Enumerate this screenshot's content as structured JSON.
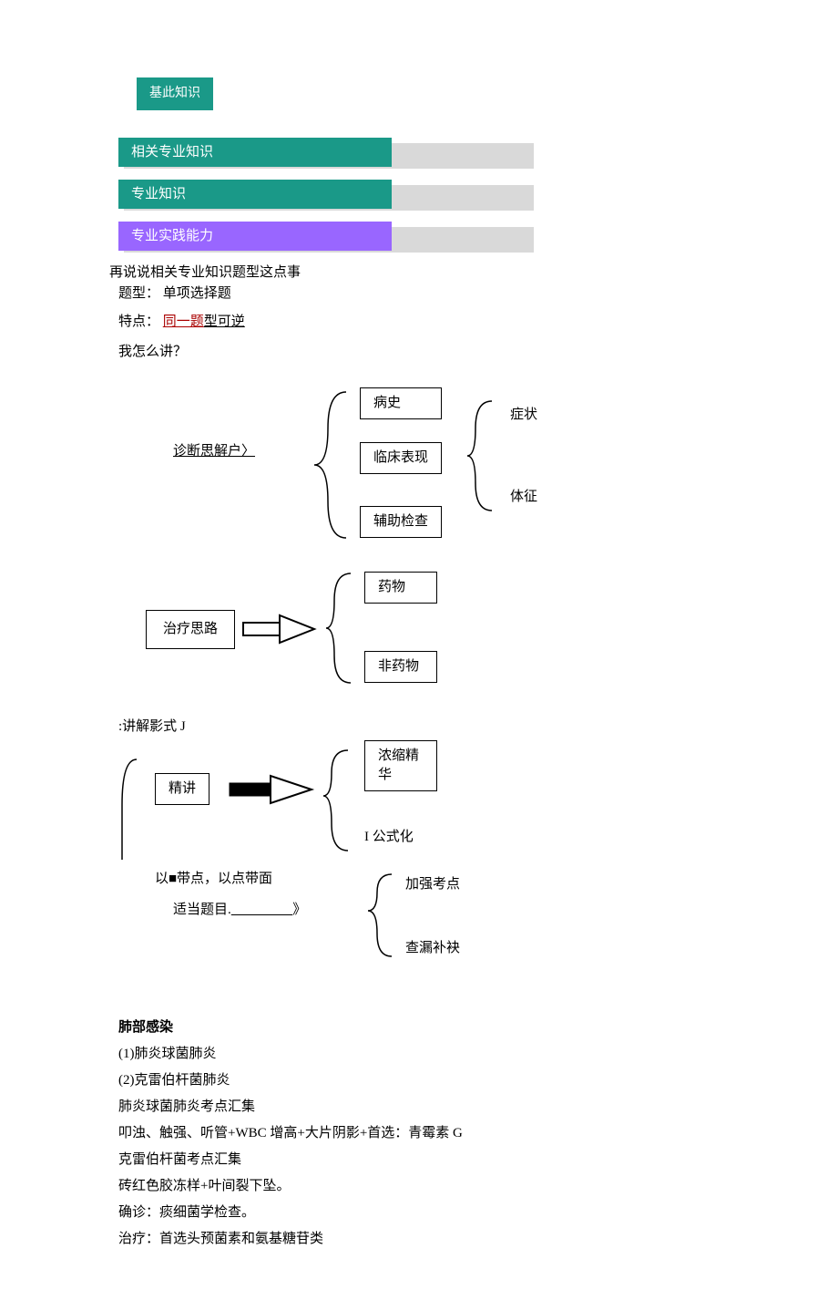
{
  "tabs": {
    "basic": "基此知识",
    "related": "相关专业知识",
    "pro": "专业知识",
    "practice": "专业实践能力"
  },
  "intro": {
    "line1": "再说说相关专业知识题型这点事",
    "line2a": "题型：",
    "line2b": "单项选择题",
    "line3a": "特点：",
    "line3b": "同一题",
    "line3c": "型可逆",
    "line4": "我怎么讲？"
  },
  "diag1": {
    "left": "诊断思解户〉",
    "n1": "病史",
    "n2": "临床表现",
    "n3": "辅助检查",
    "r1": "症状",
    "r2": "体征"
  },
  "diag2": {
    "left": "治疗思路",
    "n1": "药物",
    "n2": "非药物"
  },
  "diag3": {
    "title": ":讲解影式 J",
    "left": "精讲",
    "n1": "浓缩精华",
    "n2": "I 公式化"
  },
  "diag4": {
    "line1": "以■带点，以点带面",
    "line2a": "适当题目.",
    "line2b": "》",
    "n1": "加强考点",
    "n2": "查漏补袂"
  },
  "body": {
    "h": "肺部感染",
    "p1": "(1)肺炎球菌肺炎",
    "p2": "(2)克雷伯杆菌肺炎",
    "p3": "肺炎球菌肺炎考点汇集",
    "p4": "叩浊、触强、听管+WBC 增高+大片阴影+首选：青霉素 G",
    "p5": "克雷伯杆菌考点汇集",
    "p6": "砖红色胶冻样+叶间裂下坠。",
    "p7": "确诊：痰细菌学检查。",
    "p8": "治疗：首选头预菌素和氨基糖苷类"
  }
}
